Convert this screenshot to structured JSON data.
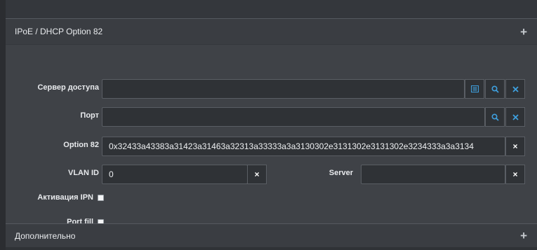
{
  "sections": {
    "ipoe_title": "IPoE / DHCP Option 82",
    "extra_title": "Дополнительно",
    "expand_glyph": "+"
  },
  "fields": {
    "access_server": {
      "label": "Сервер доступа",
      "value": ""
    },
    "port": {
      "label": "Порт",
      "value": ""
    },
    "option82": {
      "label": "Option 82",
      "value": "0x32433a43383a31423a31463a32313a33333a3a3130302e3131302e3131302e3234333a3a3134"
    },
    "vlan_id": {
      "label": "VLAN ID",
      "value": "0"
    },
    "server": {
      "label": "Server",
      "value": ""
    },
    "ipn_activation": {
      "label": "Активация IPN",
      "checked": false
    },
    "port_fill": {
      "label": "Port fill",
      "checked": false
    }
  },
  "icons": {
    "clear": "×",
    "list": "list-icon",
    "search": "search-icon"
  },
  "colors": {
    "background": "#2b2d31",
    "panel_header": "#3a3d42",
    "panel_body": "#3f4247",
    "input_bg": "#2f3236",
    "accent_blue": "#3ea0df"
  }
}
